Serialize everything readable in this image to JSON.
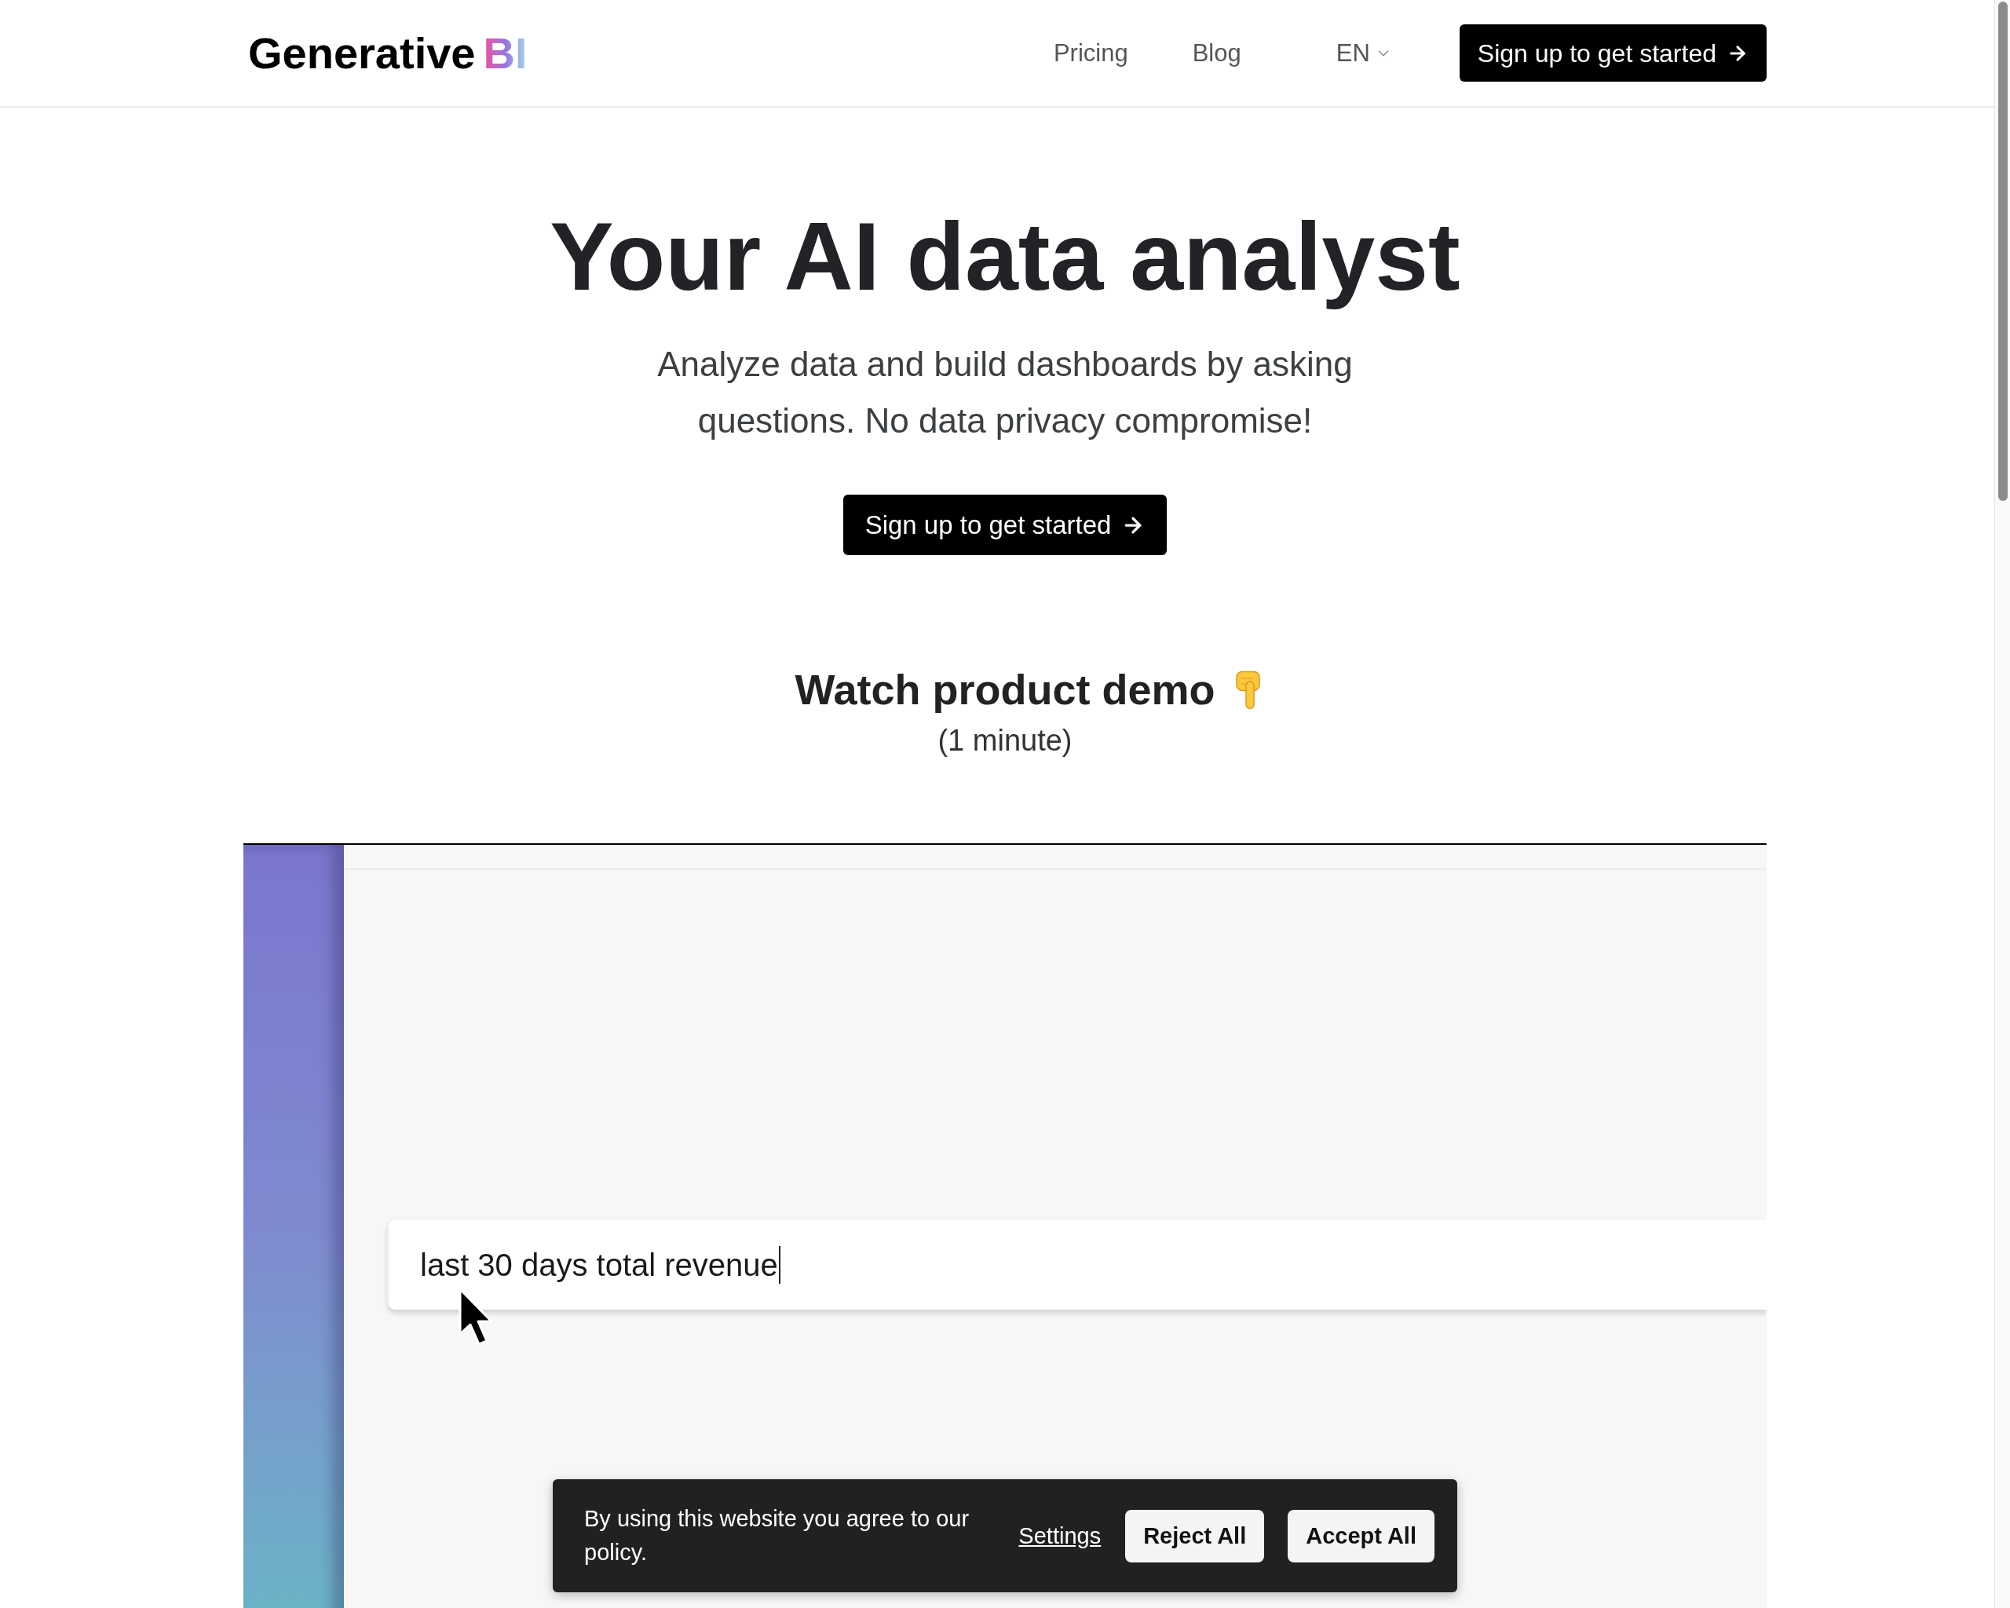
{
  "header": {
    "logo": {
      "text": "Generative",
      "accent": "BI"
    },
    "nav_links": [
      {
        "label": "Pricing"
      },
      {
        "label": "Blog"
      }
    ],
    "language": {
      "label": "EN"
    },
    "cta": "Sign up to get started"
  },
  "hero": {
    "title": "Your AI data analyst",
    "subtitle": "Analyze data and build dashboards by asking questions. No data privacy compromise!",
    "cta": "Sign up to get started"
  },
  "demo": {
    "title": "Watch product demo",
    "duration": "(1 minute)",
    "video": {
      "query": "last 30 days total revenue"
    }
  },
  "cookie_banner": {
    "message": "By using this website you agree to our policy.",
    "settings_link": "Settings",
    "buttons": [
      "Reject All",
      "Accept All"
    ]
  }
}
